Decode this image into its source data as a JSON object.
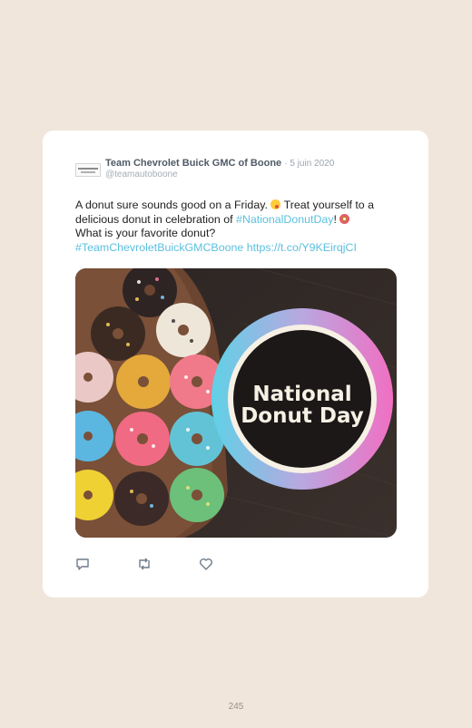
{
  "tweet": {
    "author_name": "Team Chevrolet Buick GMC of Boone",
    "separator": "·",
    "date": "5 juin 2020",
    "handle": "@teamautoboone",
    "text_1": "A donut sure sounds good on a Friday.",
    "text_2": "Treat yourself to a delicious donut in celebration of",
    "hashtag_1": "#NationalDonutDay",
    "text_3": "!",
    "text_4": "What is your favorite donut?",
    "hashtag_2": "#TeamChevroletBuickGMCBoone",
    "link": "https://t.co/Y9KEirqjCI",
    "emoji_1": "savoring-food-emoji",
    "emoji_2": "doughnut-emoji",
    "image": {
      "badge_line_1": "National",
      "badge_line_2": "Donut Day"
    },
    "actions": [
      "reply-icon",
      "retweet-icon",
      "like-icon"
    ]
  },
  "page_number": "245",
  "colors": {
    "background": "#f1e6dc",
    "card": "#ffffff",
    "link": "#5bc0de",
    "name": "#4f5a66",
    "meta": "#a3adb6"
  }
}
